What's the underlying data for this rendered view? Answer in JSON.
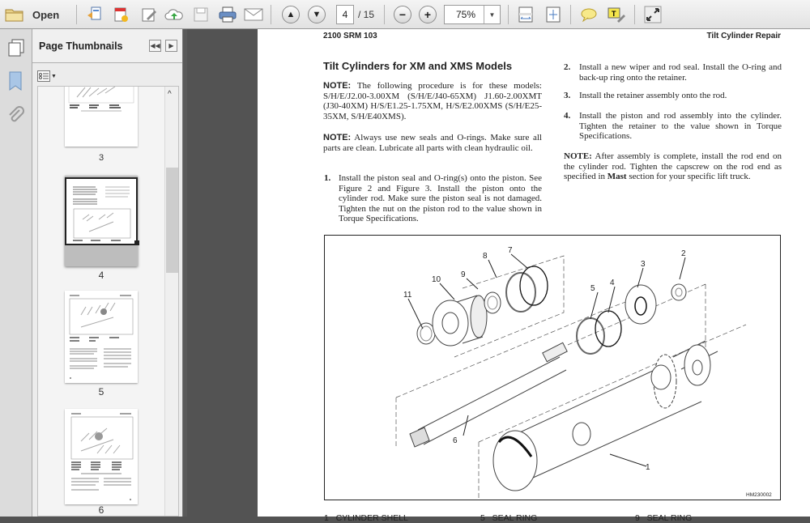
{
  "toolbar": {
    "open_label": "Open",
    "current_page": "4",
    "page_total": "/ 15",
    "zoom_value": "75%",
    "icons": [
      "folder-icon",
      "create-pdf-icon",
      "export-icon",
      "edit-icon",
      "cloud-upload-icon",
      "save-icon",
      "print-icon",
      "email-icon",
      "prev-page-icon",
      "next-page-icon",
      "zoom-out-icon",
      "zoom-in-icon",
      "zoom-dropdown-icon",
      "fit-width-icon",
      "fit-page-icon",
      "comment-icon",
      "highlight-icon",
      "fullscreen-icon"
    ]
  },
  "sidebar": {
    "title": "Page Thumbnails",
    "thumbnails": [
      {
        "label": "3"
      },
      {
        "label": "4",
        "selected": true
      },
      {
        "label": "5"
      },
      {
        "label": "6"
      }
    ]
  },
  "document": {
    "header_left": "2100 SRM 103",
    "header_right": "Tilt Cylinder Repair",
    "title": "Tilt Cylinders for XM and XMS Models",
    "note1_label": "NOTE:",
    "note1_text": "The following procedure is for these models: S/H/E/J2.00-3.00XM (S/H/E/J40-65XM) J1.60-2.00XMT (J30-40XM) H/S/E1.25-1.75XM, H/S/E2.00XMS (S/H/E25-35XM, S/H/E40XMS).",
    "note2_label": "NOTE:",
    "note2_text": "Always use new seals and O-rings. Make sure all parts are clean. Lubricate all parts with clean hydraulic oil.",
    "steps": [
      {
        "num": "1.",
        "text": "Install the piston seal and O-ring(s) onto the piston. See Figure 2 and Figure 3. Install the piston onto the cylinder rod. Make sure the piston seal is not damaged. Tighten the nut on the piston rod to the value shown in Torque Specifications."
      },
      {
        "num": "2.",
        "text": "Install a new wiper and rod seal. Install the O-ring and back-up ring onto the retainer."
      },
      {
        "num": "3.",
        "text": "Install the retainer assembly onto the rod."
      },
      {
        "num": "4.",
        "text": "Install the piston and rod assembly into the cylinder. Tighten the retainer to the value shown in Torque Specifications."
      }
    ],
    "note3_label": "NOTE:",
    "note3_text_a": "After assembly is complete, install the rod end on the cylinder rod. Tighten the capscrew on the rod end as specified in ",
    "note3_bold": "Mast",
    "note3_text_b": " section for your specific lift truck.",
    "figure": {
      "code": "HM230002",
      "callout_numbers": [
        "1",
        "2",
        "3",
        "4",
        "5",
        "6",
        "7",
        "8",
        "9",
        "10",
        "11"
      ]
    },
    "legend": [
      {
        "num": "1",
        "label": "CYLINDER SHELL"
      },
      {
        "num": "5",
        "label": "SEAL RING"
      },
      {
        "num": "9",
        "label": "SEAL RING"
      }
    ]
  }
}
